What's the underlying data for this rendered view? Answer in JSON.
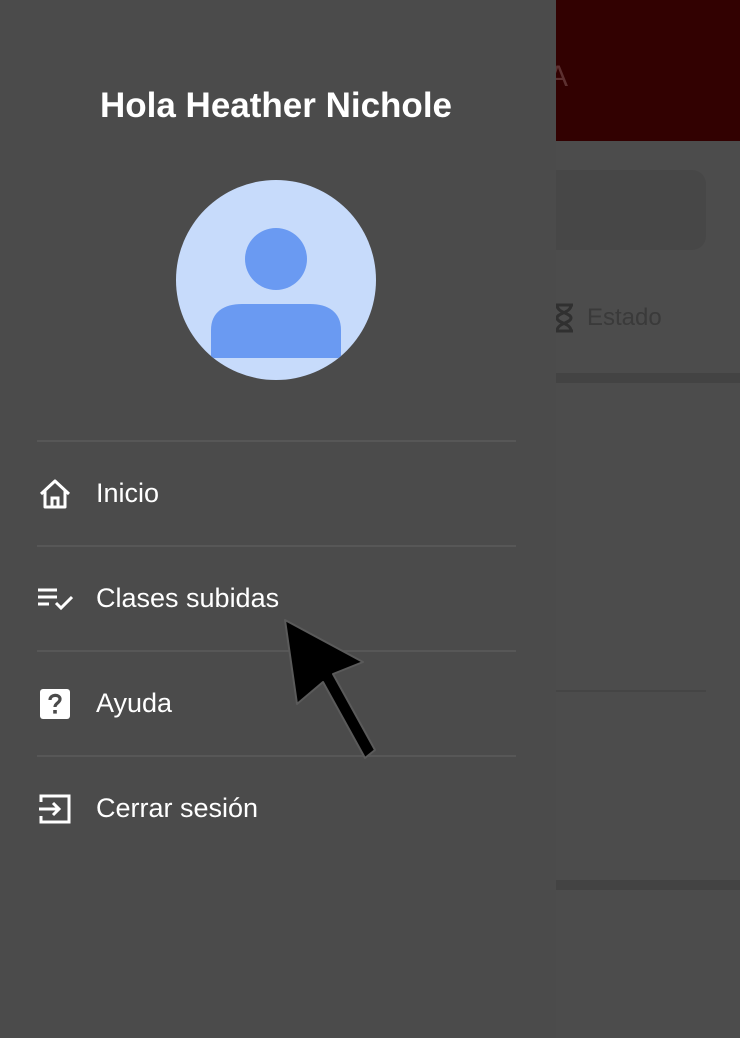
{
  "background": {
    "header_title": "A",
    "tab_label": "Estado",
    "header_color": "#320101"
  },
  "drawer": {
    "greeting": "Hola Heather Nichole",
    "avatar_colors": {
      "bg": "#c7dbfb",
      "fg": "#6a9af2"
    },
    "items": [
      {
        "label": "Inicio",
        "icon": "home-icon"
      },
      {
        "label": "Clases subidas",
        "icon": "playlist-check-icon"
      },
      {
        "label": "Ayuda",
        "icon": "help-box-icon"
      },
      {
        "label": "Cerrar sesión",
        "icon": "logout-icon"
      }
    ]
  }
}
